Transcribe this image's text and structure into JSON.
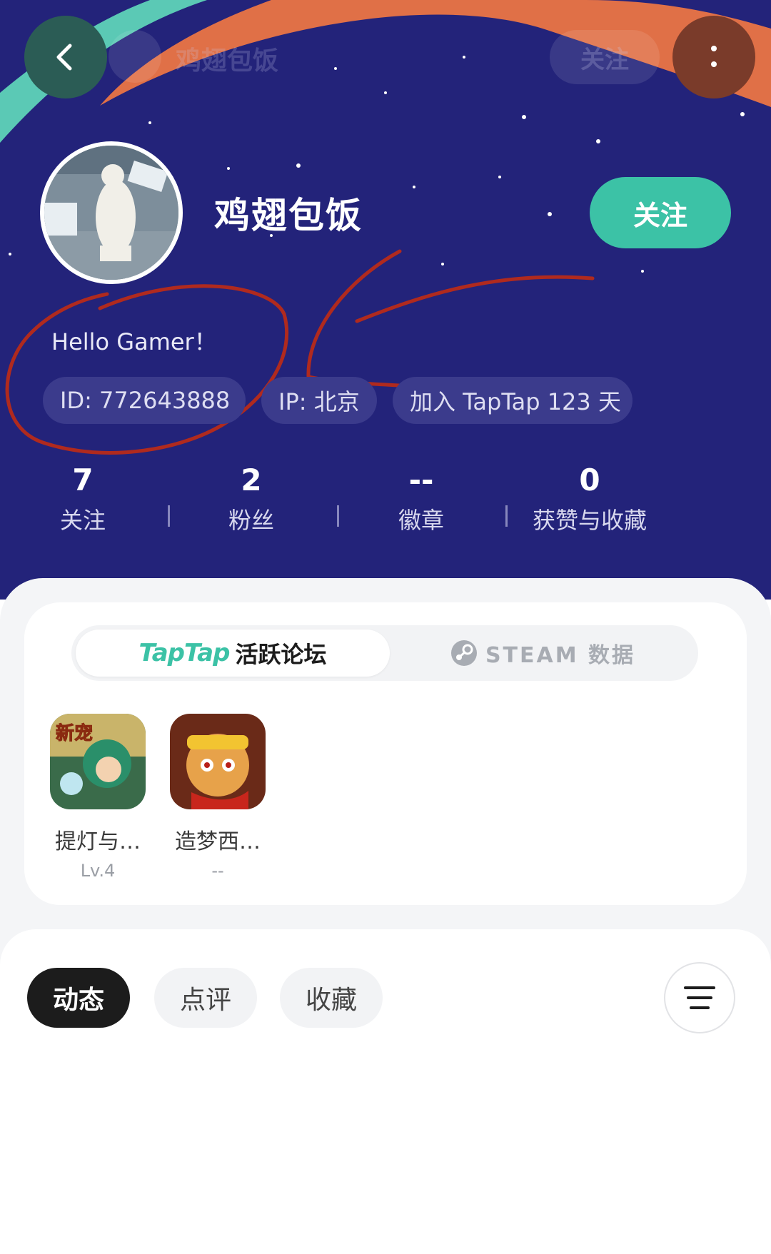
{
  "colors": {
    "hero_bg": "#23237a",
    "accent_green": "#3cc2a6",
    "accent_orange": "#e07047",
    "annotation_red": "#b02a1e",
    "dark": "#1c1c1c"
  },
  "top_bar": {
    "back_icon": "chevron-left-icon",
    "ghost_title": "鸡翅包饭",
    "ghost_follow": "关注",
    "more_icon": "vertical-dots-icon"
  },
  "profile": {
    "username": "鸡翅包饭",
    "follow_label": "关注",
    "bio": "Hello Gamer！",
    "chips": {
      "id": "ID: 772643888",
      "ip": "IP: 北京",
      "joined": "加入 TapTap 123 天"
    }
  },
  "stats": [
    {
      "value": "7",
      "label": "关注"
    },
    {
      "value": "2",
      "label": "粉丝"
    },
    {
      "value": "--",
      "label": "徽章"
    },
    {
      "value": "0",
      "label": "获赞与收藏"
    }
  ],
  "forum": {
    "tab_logo": "TapTap",
    "tab_label": "活跃论坛",
    "steam_icon": "steam-icon",
    "steam_label": "STEAM 数据",
    "games": [
      {
        "name": "提灯与…",
        "level": "Lv.4",
        "badge": "新宠"
      },
      {
        "name": "造梦西…",
        "level": "--"
      }
    ]
  },
  "feed_tabs": {
    "dynamic": "动态",
    "review": "点评",
    "collect": "收藏",
    "filter_icon": "menu-lines-icon"
  }
}
